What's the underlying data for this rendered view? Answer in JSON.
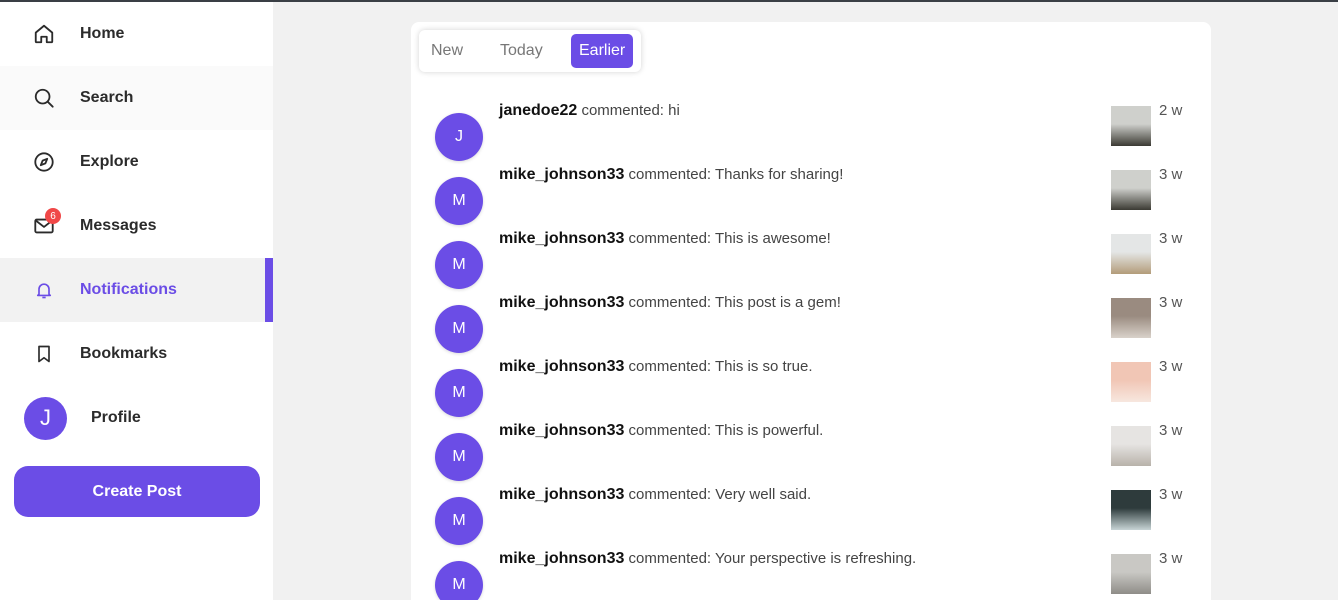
{
  "sidebar": {
    "items": [
      {
        "label": "Home",
        "icon": "home-icon"
      },
      {
        "label": "Search",
        "icon": "search-icon"
      },
      {
        "label": "Explore",
        "icon": "compass-icon"
      },
      {
        "label": "Messages",
        "icon": "mail-icon",
        "badge": "6"
      },
      {
        "label": "Notifications",
        "icon": "bell-icon"
      },
      {
        "label": "Bookmarks",
        "icon": "bookmark-icon"
      },
      {
        "label": "Profile",
        "avatar": "J"
      }
    ],
    "create_label": "Create Post"
  },
  "tabs": [
    "New",
    "Today",
    "Earlier"
  ],
  "active_tab": "Earlier",
  "accent": "#6b4de6",
  "notifications": [
    {
      "avatar": "J",
      "user": "janedoe22",
      "action": "commented: hi",
      "time": "2 w",
      "thumb_colors": [
        "#cfd0cc",
        "#3b3a33"
      ]
    },
    {
      "avatar": "M",
      "user": "mike_johnson33",
      "action": "commented: Thanks for sharing!",
      "time": "3 w",
      "thumb_colors": [
        "#cfd0cc",
        "#3b3a33"
      ]
    },
    {
      "avatar": "M",
      "user": "mike_johnson33",
      "action": "commented: This is awesome!",
      "time": "3 w",
      "thumb_colors": [
        "#e4e6e6",
        "#b39c7a"
      ]
    },
    {
      "avatar": "M",
      "user": "mike_johnson33",
      "action": "commented: This post is a gem!",
      "time": "3 w",
      "thumb_colors": [
        "#9a8b80",
        "#d9d2ca"
      ]
    },
    {
      "avatar": "M",
      "user": "mike_johnson33",
      "action": "commented: This is so true.",
      "time": "3 w",
      "thumb_colors": [
        "#f1c6b5",
        "#f7e7df"
      ]
    },
    {
      "avatar": "M",
      "user": "mike_johnson33",
      "action": "commented: This is powerful.",
      "time": "3 w",
      "thumb_colors": [
        "#e6e4e2",
        "#b8b2aa"
      ]
    },
    {
      "avatar": "M",
      "user": "mike_johnson33",
      "action": "commented: Very well said.",
      "time": "3 w",
      "thumb_colors": [
        "#2e3b3c",
        "#c8d4d6"
      ]
    },
    {
      "avatar": "M",
      "user": "mike_johnson33",
      "action": "commented: Your perspective is refreshing.",
      "time": "3 w",
      "thumb_colors": [
        "#c9c8c4",
        "#8f8d88"
      ]
    }
  ]
}
